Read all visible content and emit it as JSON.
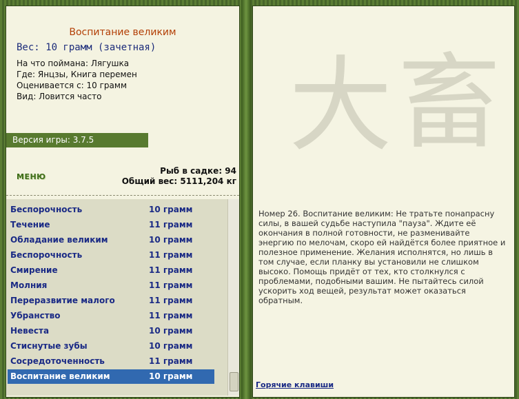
{
  "catch": {
    "title": "Воспитание великим",
    "weight": "Вес: 10 грамм (зачетная)",
    "bait": "На что поймана: Лягушка",
    "location": "Где: Янцзы, Книга перемен",
    "valued_from": "Оценивается с: 10 грамм",
    "frequency": "Вид: Ловится часто"
  },
  "version": "Версия игры: 3.7.5",
  "menu_label": "МЕНЮ",
  "stats": {
    "fish_count": "Рыб в садке: 94",
    "total_weight": "Общий вес: 5111,204 кг"
  },
  "fish_list": [
    {
      "name": "Беспорочность",
      "weight": "10 грамм"
    },
    {
      "name": "Течение",
      "weight": "11 грамм"
    },
    {
      "name": "Обладание великим",
      "weight": "10 грамм"
    },
    {
      "name": "Беспорочность",
      "weight": "11 грамм"
    },
    {
      "name": "Смирение",
      "weight": "11 грамм"
    },
    {
      "name": "Молния",
      "weight": "11 грамм"
    },
    {
      "name": "Переразвитие малого",
      "weight": "11 грамм"
    },
    {
      "name": "Убранство",
      "weight": "11 грамм"
    },
    {
      "name": "Невеста",
      "weight": "10 грамм"
    },
    {
      "name": "Стиснутые зубы",
      "weight": "10 грамм"
    },
    {
      "name": "Сосредоточенность",
      "weight": "11 грамм"
    },
    {
      "name": "Воспитание великим",
      "weight": "10 грамм"
    }
  ],
  "hexagram_glyphs": [
    "大",
    "畜"
  ],
  "description": "Номер 26. Воспитание великим: Не тратьте понапрасну силы, в вашей судьбе наступила \"пауза\". Ждите её окончания в полной готовности, не разменивайте энергию по мелочам, скоро ей найдётся более приятное и полезное применение. Желания исполнятся, но лишь в том случае, если планку вы установили не слишком высоко. Помощь придёт от тех, кто столкнулся с проблемами, подобными вашим. Не пытайтесь силой ускорить ход вещей, результат может оказаться обратным.",
  "hotkeys_label": "Горячие клавиши",
  "colors": {
    "frame": "#4f6e2c",
    "panel": "#f4f3e1",
    "title": "#b33f06",
    "list_text": "#1a2a85",
    "selection": "#3169b0"
  }
}
